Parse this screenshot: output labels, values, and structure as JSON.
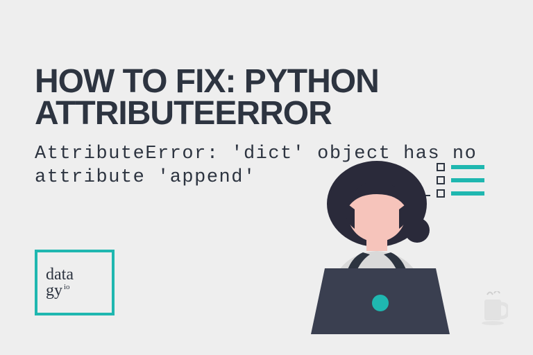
{
  "title": {
    "line1": "How to Fix: Python",
    "line2": "AttributeError"
  },
  "subtitle": {
    "line1": "AttributeError: 'dict' object has no",
    "line2": "attribute 'append'"
  },
  "logo": {
    "line1": "data",
    "line2": "gy",
    "suffix": "io"
  },
  "colors": {
    "accent": "#1fb7b0",
    "dark": "#2d3440",
    "bg": "#eeeeee",
    "skin": "#f6c4bb",
    "hair": "#2a2a3a",
    "shirt": "#d9d9d9",
    "strap": "#2d3440",
    "laptop": "#3a3f50",
    "laptop_dot": "#1fb7b0"
  }
}
